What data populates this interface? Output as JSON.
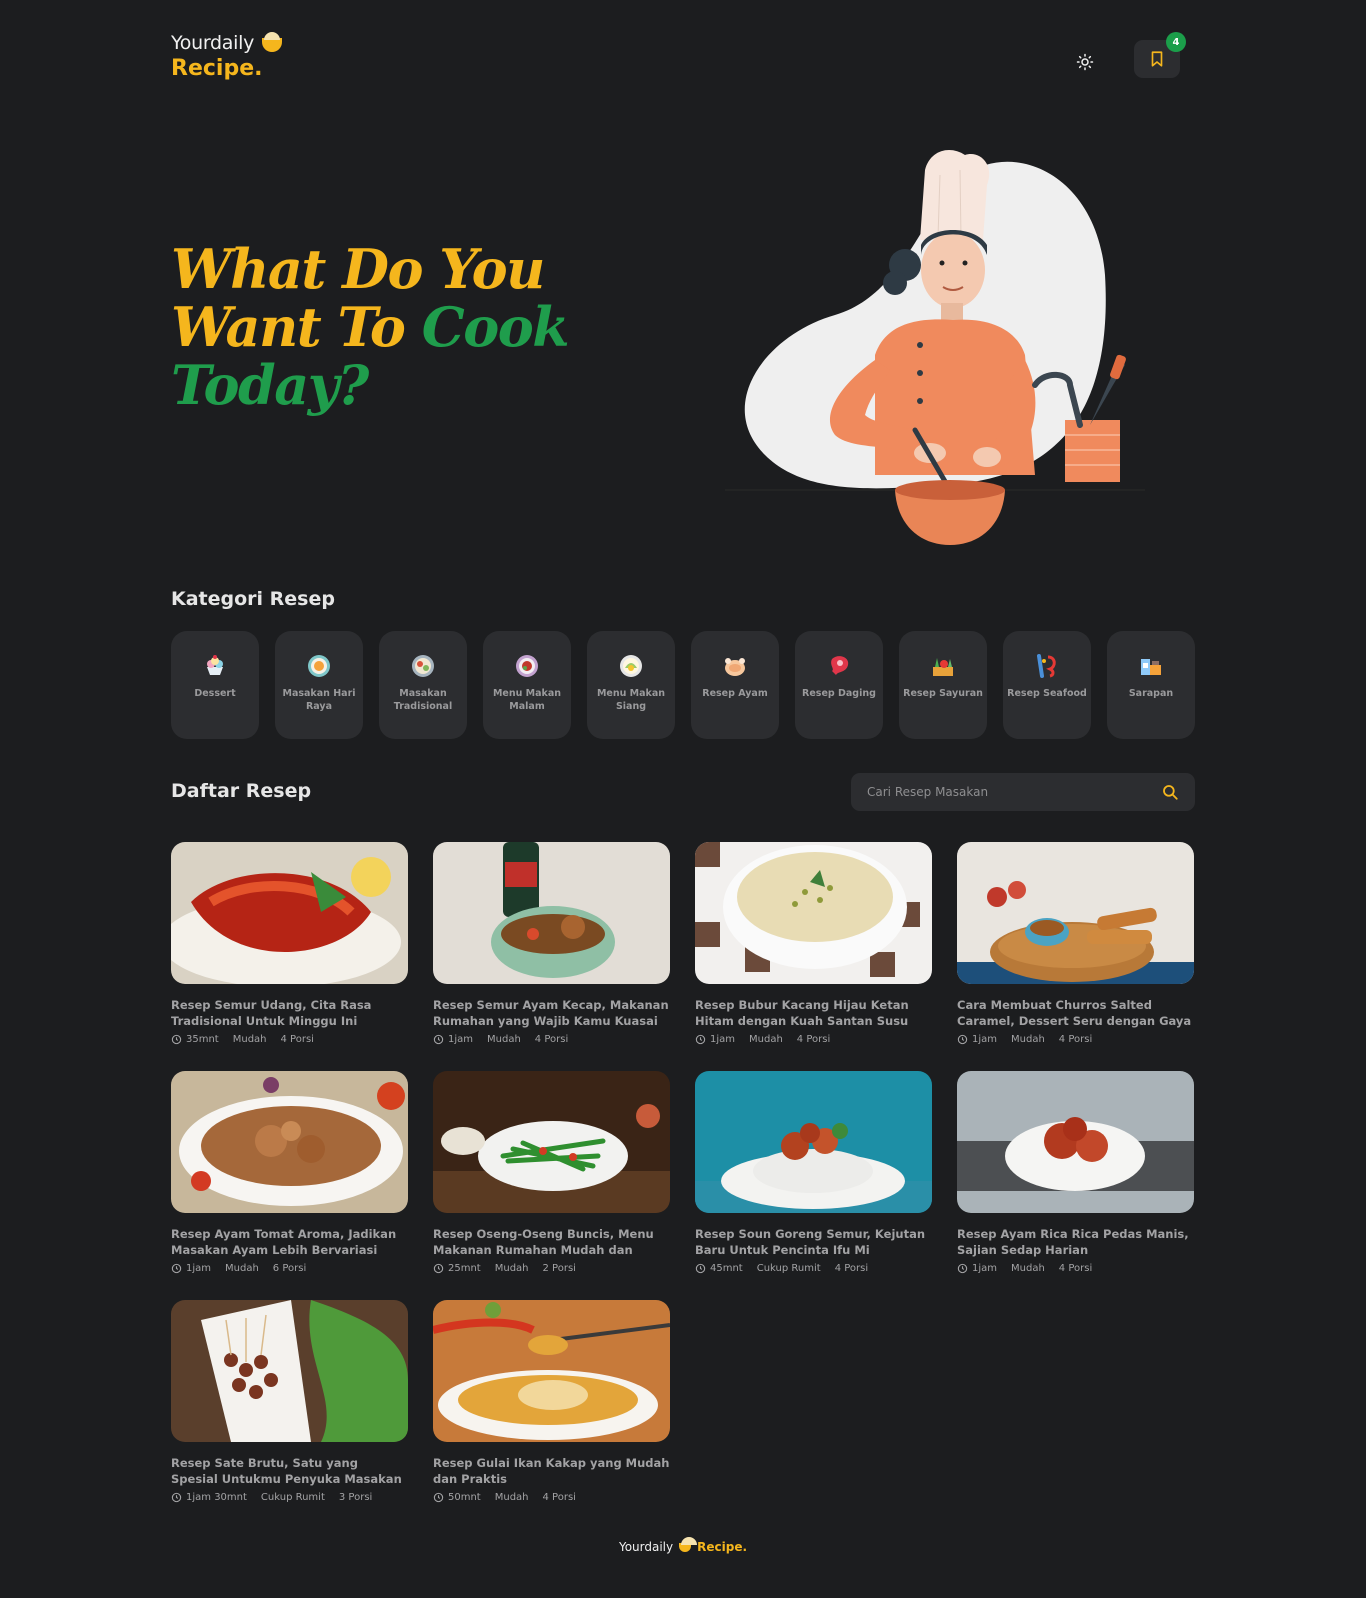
{
  "brand": {
    "top": "Yourdaily",
    "bottom": "Recipe."
  },
  "header": {
    "bookmark_count": "4",
    "theme_icon": "sun-icon",
    "bookmark_icon": "bookmark-icon"
  },
  "hero": {
    "line1": "What Do You",
    "line2a": "Want To ",
    "line2b": "Cook",
    "line3": "Today?"
  },
  "categories_title": "Kategori Resep",
  "categories": [
    {
      "label": "Dessert",
      "icon": "ice-cream-icon"
    },
    {
      "label": "Masakan Hari Raya",
      "icon": "festive-plate-icon"
    },
    {
      "label": "Masakan Tradisional",
      "icon": "traditional-plate-icon"
    },
    {
      "label": "Menu Makan Malam",
      "icon": "dinner-plate-icon"
    },
    {
      "label": "Menu Makan Siang",
      "icon": "lunch-plate-icon"
    },
    {
      "label": "Resep Ayam",
      "icon": "chicken-icon"
    },
    {
      "label": "Resep Daging",
      "icon": "meat-icon"
    },
    {
      "label": "Resep Sayuran",
      "icon": "vegetable-icon"
    },
    {
      "label": "Resep Seafood",
      "icon": "seafood-icon"
    },
    {
      "label": "Sarapan",
      "icon": "breakfast-icon"
    }
  ],
  "recipes_title": "Daftar Resep",
  "search": {
    "placeholder": "Cari Resep Masakan"
  },
  "recipes": [
    {
      "title": "Resep Semur Udang, Cita Rasa Tradisional Untuk Minggu Ini",
      "time": "35mnt",
      "difficulty": "Mudah",
      "portion": "4 Porsi"
    },
    {
      "title": "Resep Semur Ayam Kecap, Makanan Rumahan yang Wajib Kamu Kuasai",
      "time": "1jam",
      "difficulty": "Mudah",
      "portion": "4 Porsi"
    },
    {
      "title": "Resep Bubur Kacang Hijau Ketan Hitam dengan Kuah Santan Susu",
      "time": "1jam",
      "difficulty": "Mudah",
      "portion": "4 Porsi"
    },
    {
      "title": "Cara Membuat Churros Salted Caramel, Dessert Seru dengan Gaya Baru",
      "time": "1jam",
      "difficulty": "Mudah",
      "portion": "4 Porsi"
    },
    {
      "title": "Resep Ayam Tomat Aroma, Jadikan Masakan Ayam Lebih Bervariasi",
      "time": "1jam",
      "difficulty": "Mudah",
      "portion": "6 Porsi"
    },
    {
      "title": "Resep Oseng-Oseng Buncis, Menu Makanan Rumahan Mudah dan Sedap",
      "time": "25mnt",
      "difficulty": "Mudah",
      "portion": "2 Porsi"
    },
    {
      "title": "Resep Soun Goreng Semur, Kejutan Baru Untuk Pencinta Ifu Mi",
      "time": "45mnt",
      "difficulty": "Cukup Rumit",
      "portion": "4 Porsi"
    },
    {
      "title": "Resep Ayam Rica Rica Pedas Manis, Sajian Sedap Harian",
      "time": "1jam",
      "difficulty": "Mudah",
      "portion": "4 Porsi"
    },
    {
      "title": "Resep Sate Brutu, Satu yang Spesial Untukmu Penyuka Masakan Gurih",
      "time": "1jam 30mnt",
      "difficulty": "Cukup Rumit",
      "portion": "3 Porsi"
    },
    {
      "title": "Resep Gulai Ikan Kakap yang Mudah dan Praktis",
      "time": "50mnt",
      "difficulty": "Mudah",
      "portion": "4 Porsi"
    }
  ],
  "footer": {
    "left": "Yourdaily",
    "right": "Recipe."
  },
  "colors": {
    "background": "#1c1d1f",
    "card": "#2c2d30",
    "accent": "#f5b61d",
    "green": "#1f9d4c"
  }
}
